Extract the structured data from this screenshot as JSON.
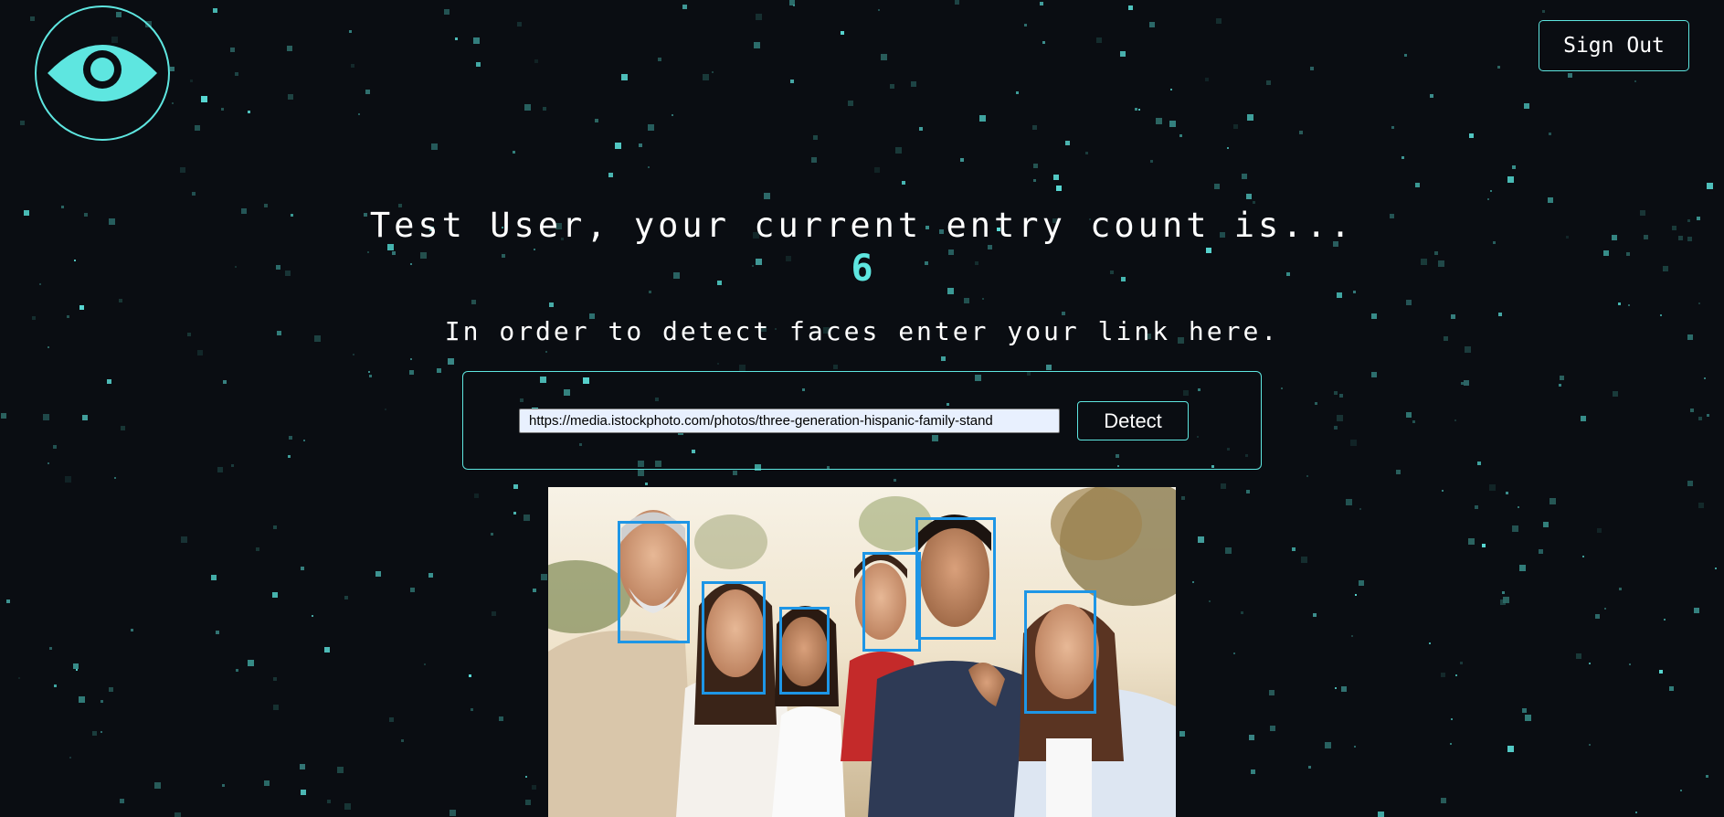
{
  "header": {
    "logo_icon": "eye-icon",
    "signout_label": "Sign Out"
  },
  "main": {
    "greeting": "Test User, your current entry count is...",
    "entry_count": "6",
    "instructions": "In order to detect faces enter your link here.",
    "url_value": "https://media.istockphoto.com/photos/three-generation-hispanic-family-stand",
    "detect_label": "Detect"
  },
  "colors": {
    "background": "#0a0d12",
    "accent": "#5ee6e0",
    "face_box": "#1e96e6"
  }
}
